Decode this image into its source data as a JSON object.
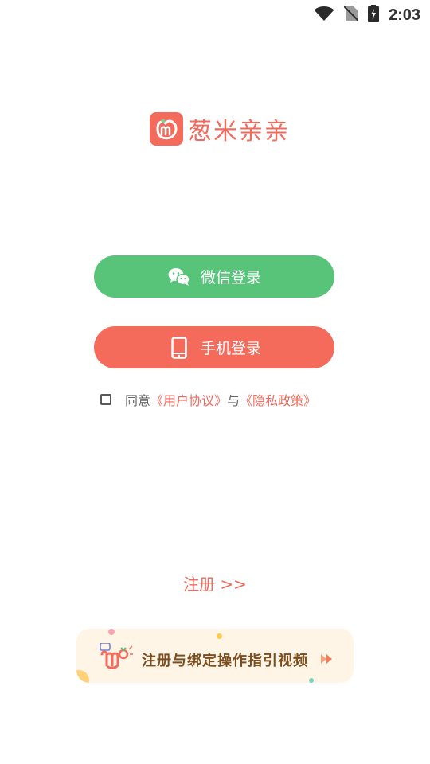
{
  "status_bar": {
    "time": "2:03",
    "icons": [
      "wifi-icon",
      "no-sim-icon",
      "battery-charging-icon"
    ]
  },
  "logo": {
    "text": "葱米亲亲",
    "icon": "app-logo-icon",
    "brand_color": "#f46b5b"
  },
  "login": {
    "wechat_label": "微信登录",
    "wechat_icon": "wechat-icon",
    "wechat_color": "#58c47a",
    "phone_label": "手机登录",
    "phone_icon": "phone-icon",
    "phone_color": "#f46b5b"
  },
  "agreement": {
    "prefix": "同意",
    "user_agreement": "《用户协议》",
    "connector": "与",
    "privacy_policy": "《隐私政策》",
    "checked": false
  },
  "register": {
    "label": "注册 >>"
  },
  "guide": {
    "label": "注册与绑定操作指引视频",
    "icon": "play-forward-icon"
  }
}
